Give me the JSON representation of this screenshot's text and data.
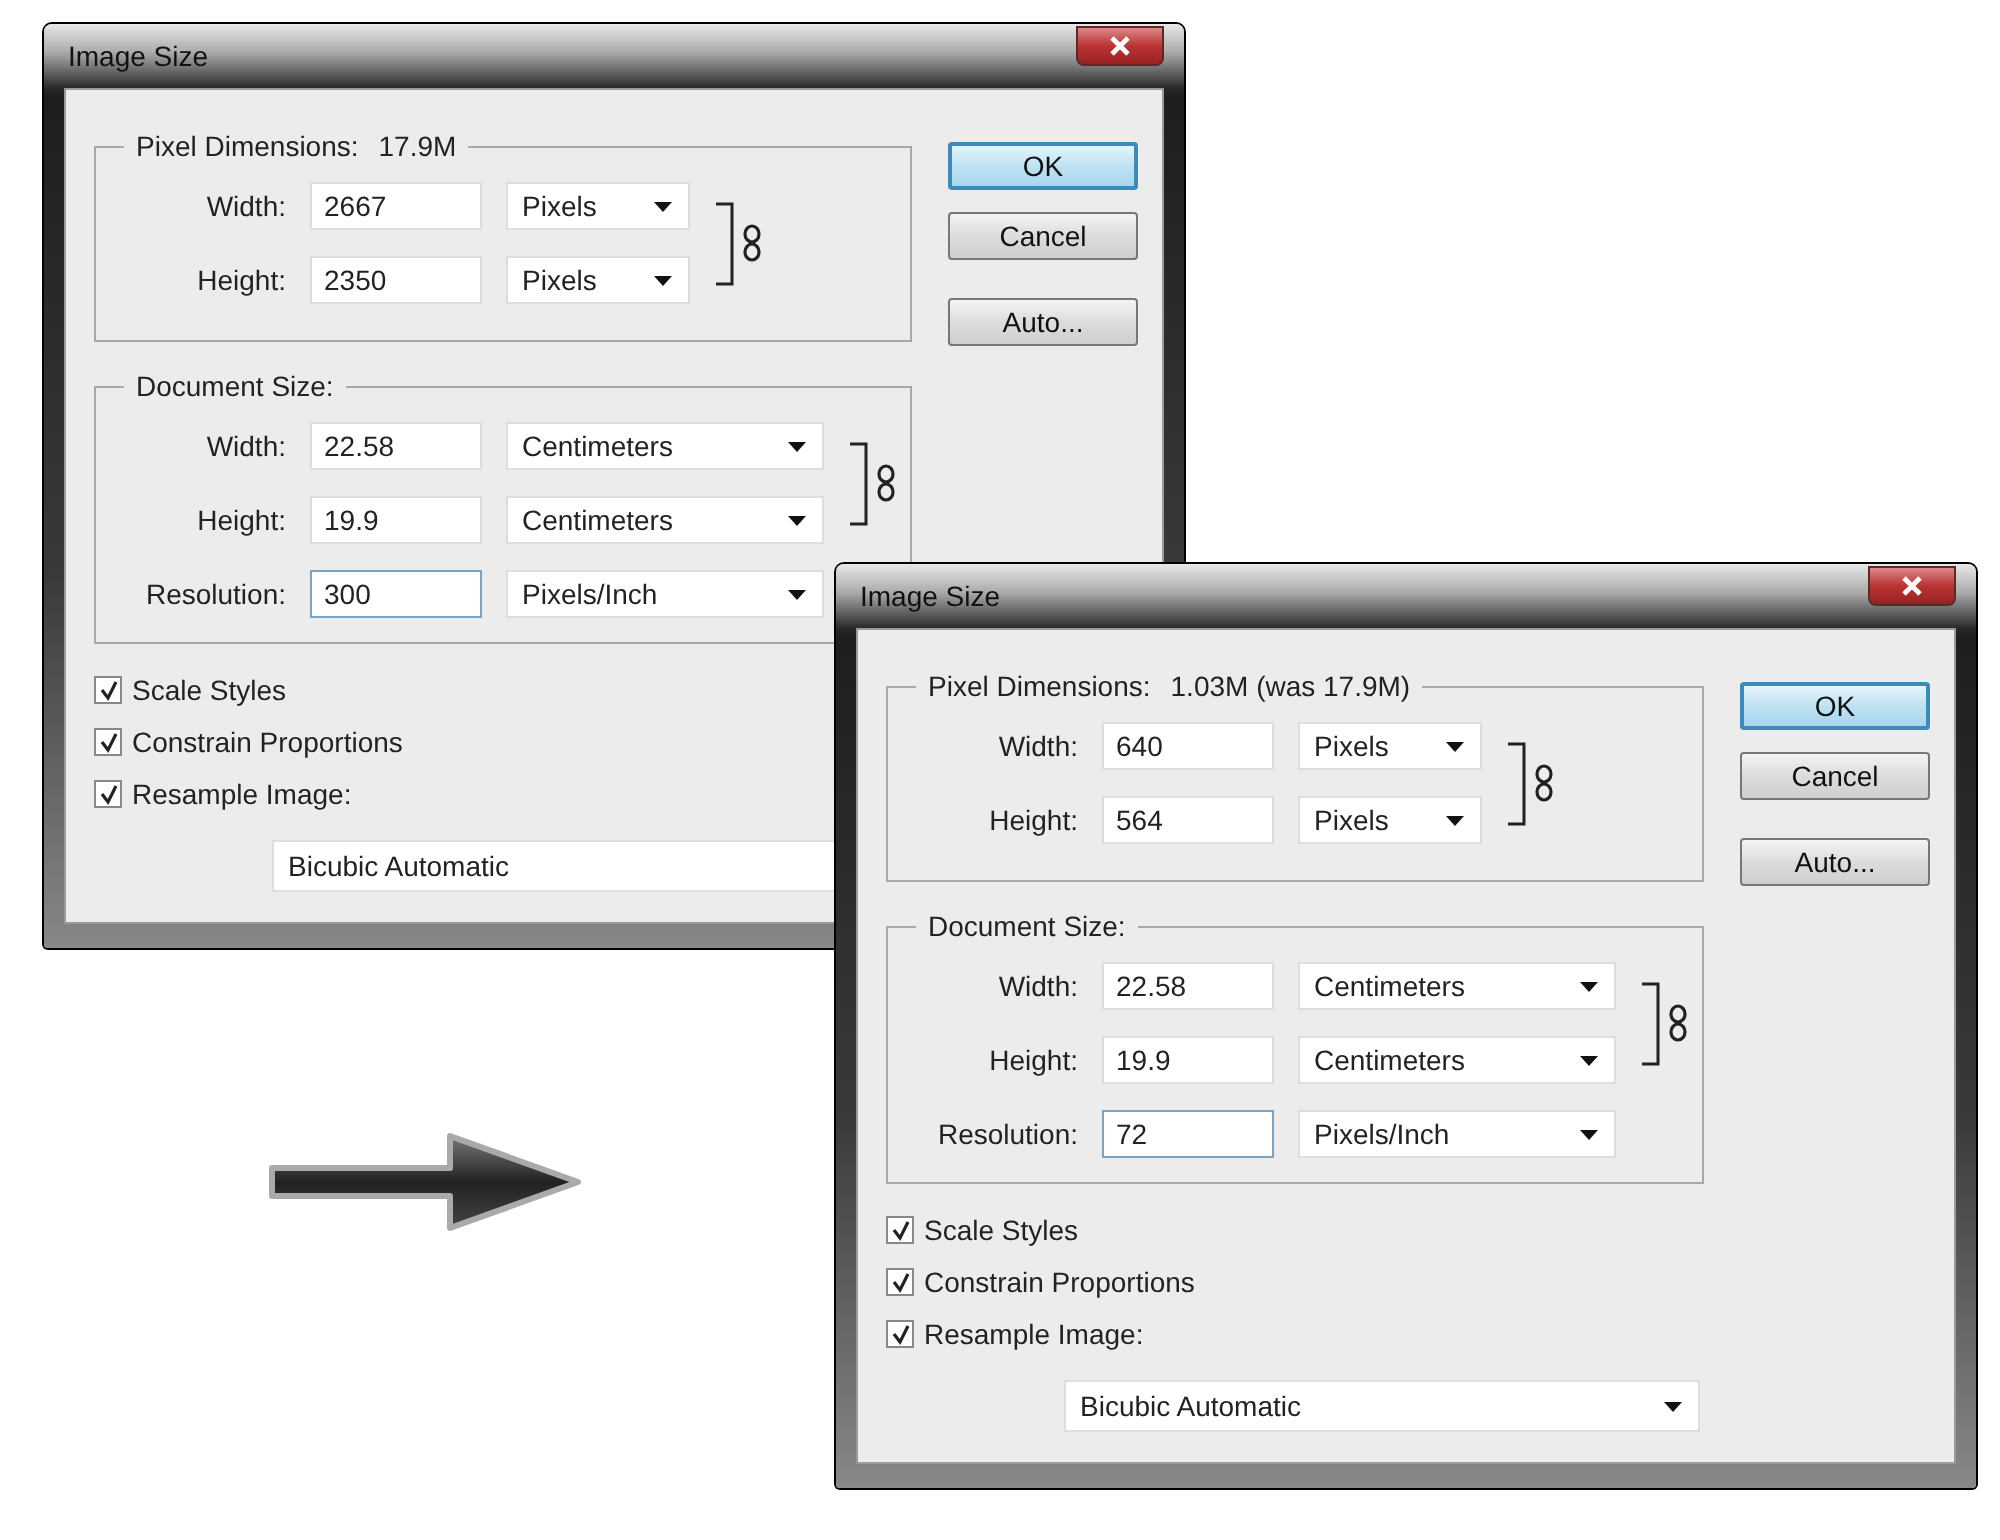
{
  "dialogs": [
    {
      "title": "Image Size",
      "pixel_dimensions": {
        "label": "Pixel Dimensions:",
        "value": "17.9M",
        "fields": [
          {
            "label": "Width:",
            "value": "2667",
            "unit": "Pixels",
            "focused": false
          },
          {
            "label": "Height:",
            "value": "2350",
            "unit": "Pixels",
            "focused": false
          }
        ]
      },
      "document_size": {
        "label": "Document Size:",
        "fields": [
          {
            "label": "Width:",
            "value": "22.58",
            "unit": "Centimeters",
            "focused": false
          },
          {
            "label": "Height:",
            "value": "19.9",
            "unit": "Centimeters",
            "focused": false
          },
          {
            "label": "Resolution:",
            "value": "300",
            "unit": "Pixels/Inch",
            "focused": true
          }
        ]
      },
      "checkboxes": [
        {
          "label": "Scale Styles",
          "checked": true
        },
        {
          "label": "Constrain Proportions",
          "checked": true
        },
        {
          "label": "Resample Image:",
          "checked": true
        }
      ],
      "resample_method": "Bicubic Automatic",
      "buttons": [
        {
          "label": "OK",
          "default": true
        },
        {
          "label": "Cancel",
          "default": false
        },
        {
          "label": "Auto...",
          "default": false
        }
      ]
    },
    {
      "title": "Image Size",
      "pixel_dimensions": {
        "label": "Pixel Dimensions:",
        "value": "1.03M (was 17.9M)",
        "fields": [
          {
            "label": "Width:",
            "value": "640",
            "unit": "Pixels",
            "focused": false
          },
          {
            "label": "Height:",
            "value": "564",
            "unit": "Pixels",
            "focused": false
          }
        ]
      },
      "document_size": {
        "label": "Document Size:",
        "fields": [
          {
            "label": "Width:",
            "value": "22.58",
            "unit": "Centimeters",
            "focused": false
          },
          {
            "label": "Height:",
            "value": "19.9",
            "unit": "Centimeters",
            "focused": false
          },
          {
            "label": "Resolution:",
            "value": "72",
            "unit": "Pixels/Inch",
            "focused": true
          }
        ]
      },
      "checkboxes": [
        {
          "label": "Scale Styles",
          "checked": true
        },
        {
          "label": "Constrain Proportions",
          "checked": true
        },
        {
          "label": "Resample Image:",
          "checked": true
        }
      ],
      "resample_method": "Bicubic Automatic",
      "buttons": [
        {
          "label": "OK",
          "default": true
        },
        {
          "label": "Cancel",
          "default": false
        },
        {
          "label": "Auto...",
          "default": false
        }
      ]
    }
  ]
}
